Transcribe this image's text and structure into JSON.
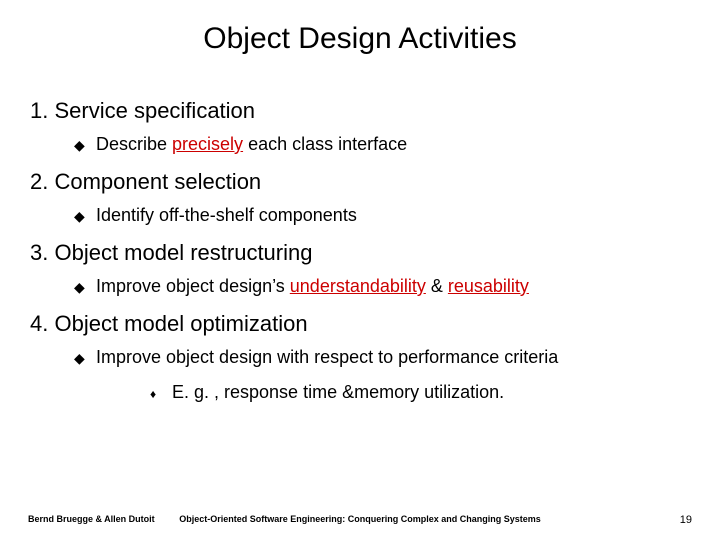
{
  "title": "Object Design Activities",
  "items": [
    {
      "num": "1.",
      "heading": "Service specification",
      "bullets": [
        {
          "pre": "Describe ",
          "hl": "precisely",
          "post": " each class interface"
        }
      ]
    },
    {
      "num": "2.",
      "heading": "Component selection",
      "bullets": [
        {
          "pre": "Identify off-the-shelf components",
          "hl": "",
          "post": ""
        }
      ]
    },
    {
      "num": "3.",
      "heading": "Object model restructuring",
      "bullets": [
        {
          "pre": "Improve object design’s ",
          "hl": "understandability",
          "mid": " & ",
          "hl2": "reusability",
          "post": ""
        }
      ]
    },
    {
      "num": "4.",
      "heading": "Object model optimization",
      "bullets": [
        {
          "pre": "Improve object design with respect to performance criteria",
          "hl": "",
          "post": ""
        }
      ],
      "sub": {
        "text": "E. g. , response time &memory utilization."
      }
    }
  ],
  "footer": {
    "left": "Bernd Bruegge & Allen Dutoit",
    "center": "Object-Oriented Software Engineering: Conquering Complex and Changing Systems",
    "right": "19"
  }
}
